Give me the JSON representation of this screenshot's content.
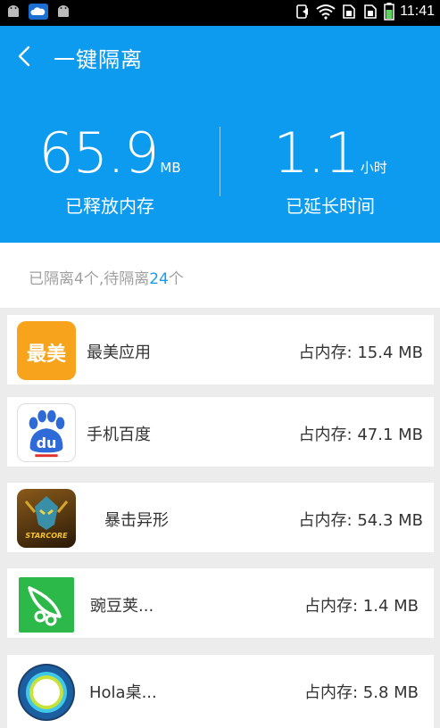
{
  "status_bar": {
    "time": "11:41"
  },
  "header": {
    "title": "一键隔离"
  },
  "stats": {
    "left": {
      "value": "65.9",
      "unit": "MB",
      "label": "已释放内存"
    },
    "right": {
      "value": "1.1",
      "unit": "小时",
      "label": "已延长时间"
    }
  },
  "summary": {
    "prefix": "已隔离4个,待隔离",
    "count": "24",
    "suffix": "个"
  },
  "apps": [
    {
      "name": "最美应用",
      "memory": "占内存: 15.4 MB",
      "icon_text": "最美",
      "icon": "zuimei-icon"
    },
    {
      "name": "手机百度",
      "memory": "占内存: 47.1 MB",
      "icon_text": "du",
      "icon": "baidu-icon"
    },
    {
      "name": "暴击异形",
      "memory": "占内存: 54.3 MB",
      "icon_text": "STARCORE",
      "icon": "game-icon"
    },
    {
      "name": "豌豆荚...",
      "memory": "占内存: 1.4 MB",
      "icon_text": "",
      "icon": "wandoujia-icon"
    },
    {
      "name": "Hola桌...",
      "memory": "占内存: 5.8 MB",
      "icon_text": "",
      "icon": "hola-icon"
    }
  ],
  "colors": {
    "primary": "#0d9bf0",
    "highlight": "#1a9bf0",
    "zuimei": "#f7a31c",
    "wandoujia": "#2db84a"
  }
}
